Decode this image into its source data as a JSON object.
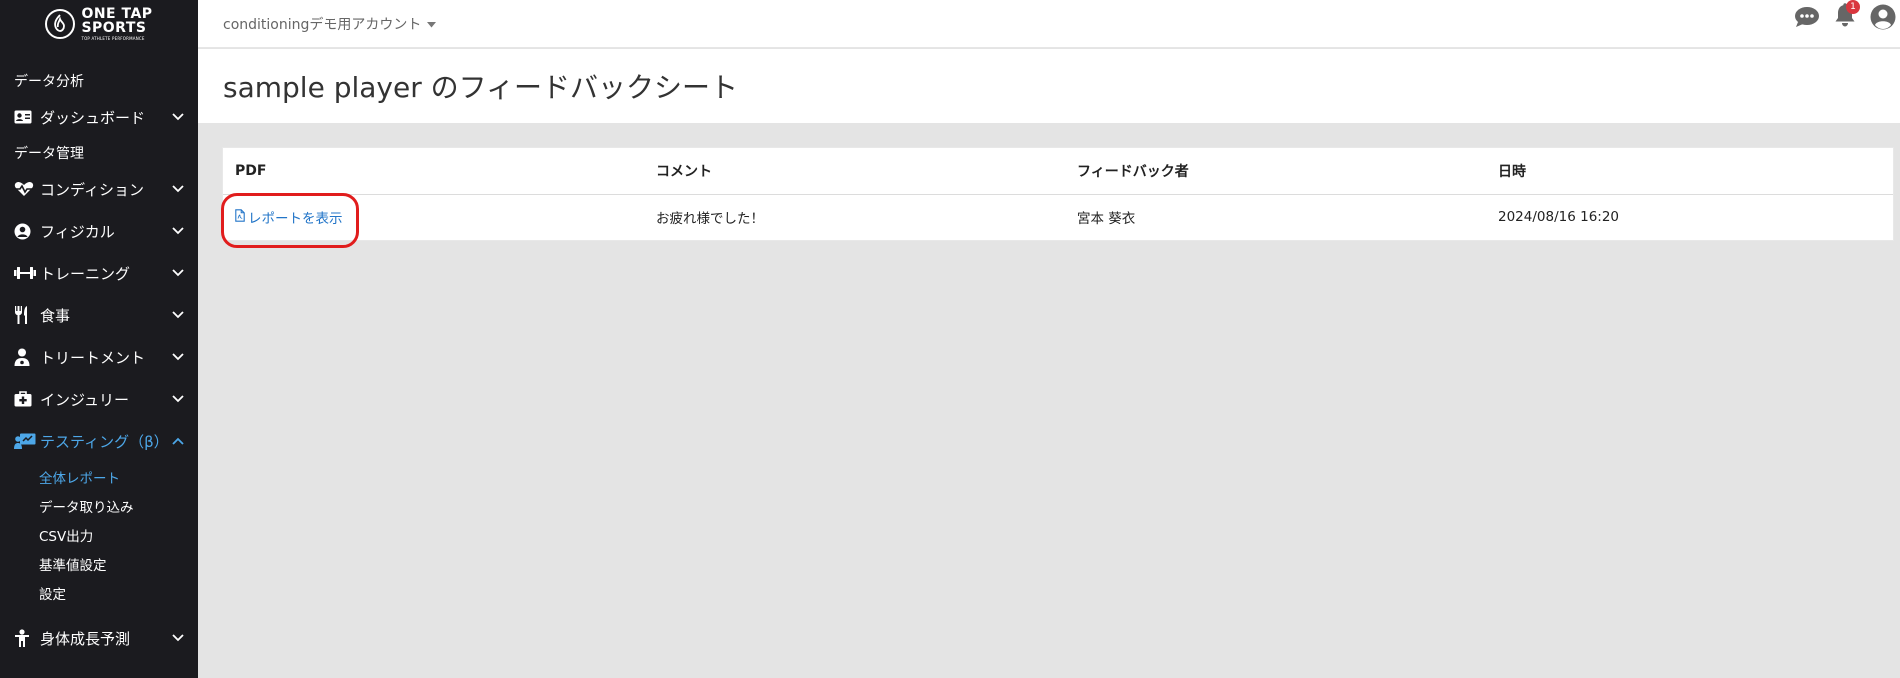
{
  "logo": {
    "line1": "ONE TAP",
    "line2": "SPORTS",
    "tagline": "TOP ATHLETE PERFORMANCE"
  },
  "sidebar": {
    "section_analysis": "データ分析",
    "dashboard": "ダッシュボード",
    "section_manage": "データ管理",
    "condition": "コンディション",
    "physical": "フィジカル",
    "training": "トレーニング",
    "meal": "食事",
    "treatment": "トリートメント",
    "injury": "インジュリー",
    "testing": "テスティング（β）",
    "sub_items": [
      "全体レポート",
      "データ取り込み",
      "CSV出力",
      "基準値設定",
      "設定"
    ],
    "growth": "身体成長予測"
  },
  "header": {
    "account": "conditioningデモ用アカウント",
    "notification_count": "1"
  },
  "page": {
    "title": "sample player のフィードバックシート"
  },
  "table": {
    "headers": [
      "PDF",
      "コメント",
      "フィードバック者",
      "日時"
    ],
    "rows": [
      {
        "pdf": "レポートを表示",
        "comment": "お疲れ様でした！",
        "author": "宮本 葵衣",
        "datetime": "2024/08/16 16:20"
      }
    ]
  },
  "colors": {
    "sidebar_bg": "#1b1b1f",
    "active": "#4da7e8",
    "link": "#2275c8",
    "highlight": "#e11d1d"
  }
}
